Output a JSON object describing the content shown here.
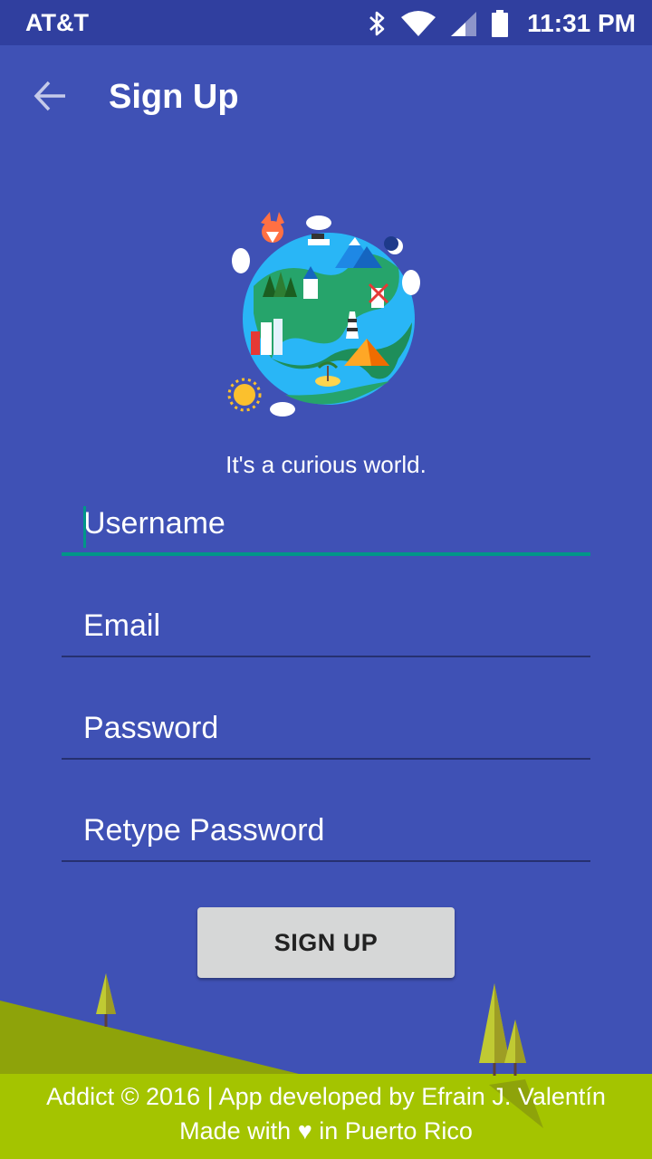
{
  "status_bar": {
    "carrier": "AT&T",
    "time": "11:31 PM",
    "icons": [
      "bluetooth-icon",
      "wifi-icon",
      "cell-signal-icon",
      "battery-icon"
    ]
  },
  "app_bar": {
    "title": "Sign Up",
    "back_icon": "arrow-left-icon"
  },
  "hero": {
    "illustration": "world-globe-illustration",
    "tagline": "It's a curious world."
  },
  "form": {
    "username_placeholder": "Username",
    "email_placeholder": "Email",
    "password_placeholder": "Password",
    "retype_password_placeholder": "Retype Password",
    "username_value": "",
    "email_value": "",
    "password_value": "",
    "retype_password_value": "",
    "submit_label": "SIGN UP"
  },
  "footer": {
    "line1": "Addict © 2016 | App developed by Efrain J. Valentín",
    "line2_prefix": "Made with",
    "line2_heart": "♥",
    "line2_suffix": "in Puerto Rico"
  },
  "colors": {
    "primary": "#3f51b5",
    "primary_dark": "#303f9f",
    "accent": "#009688",
    "ground": "#a4c400",
    "button": "#d6d7d7"
  }
}
